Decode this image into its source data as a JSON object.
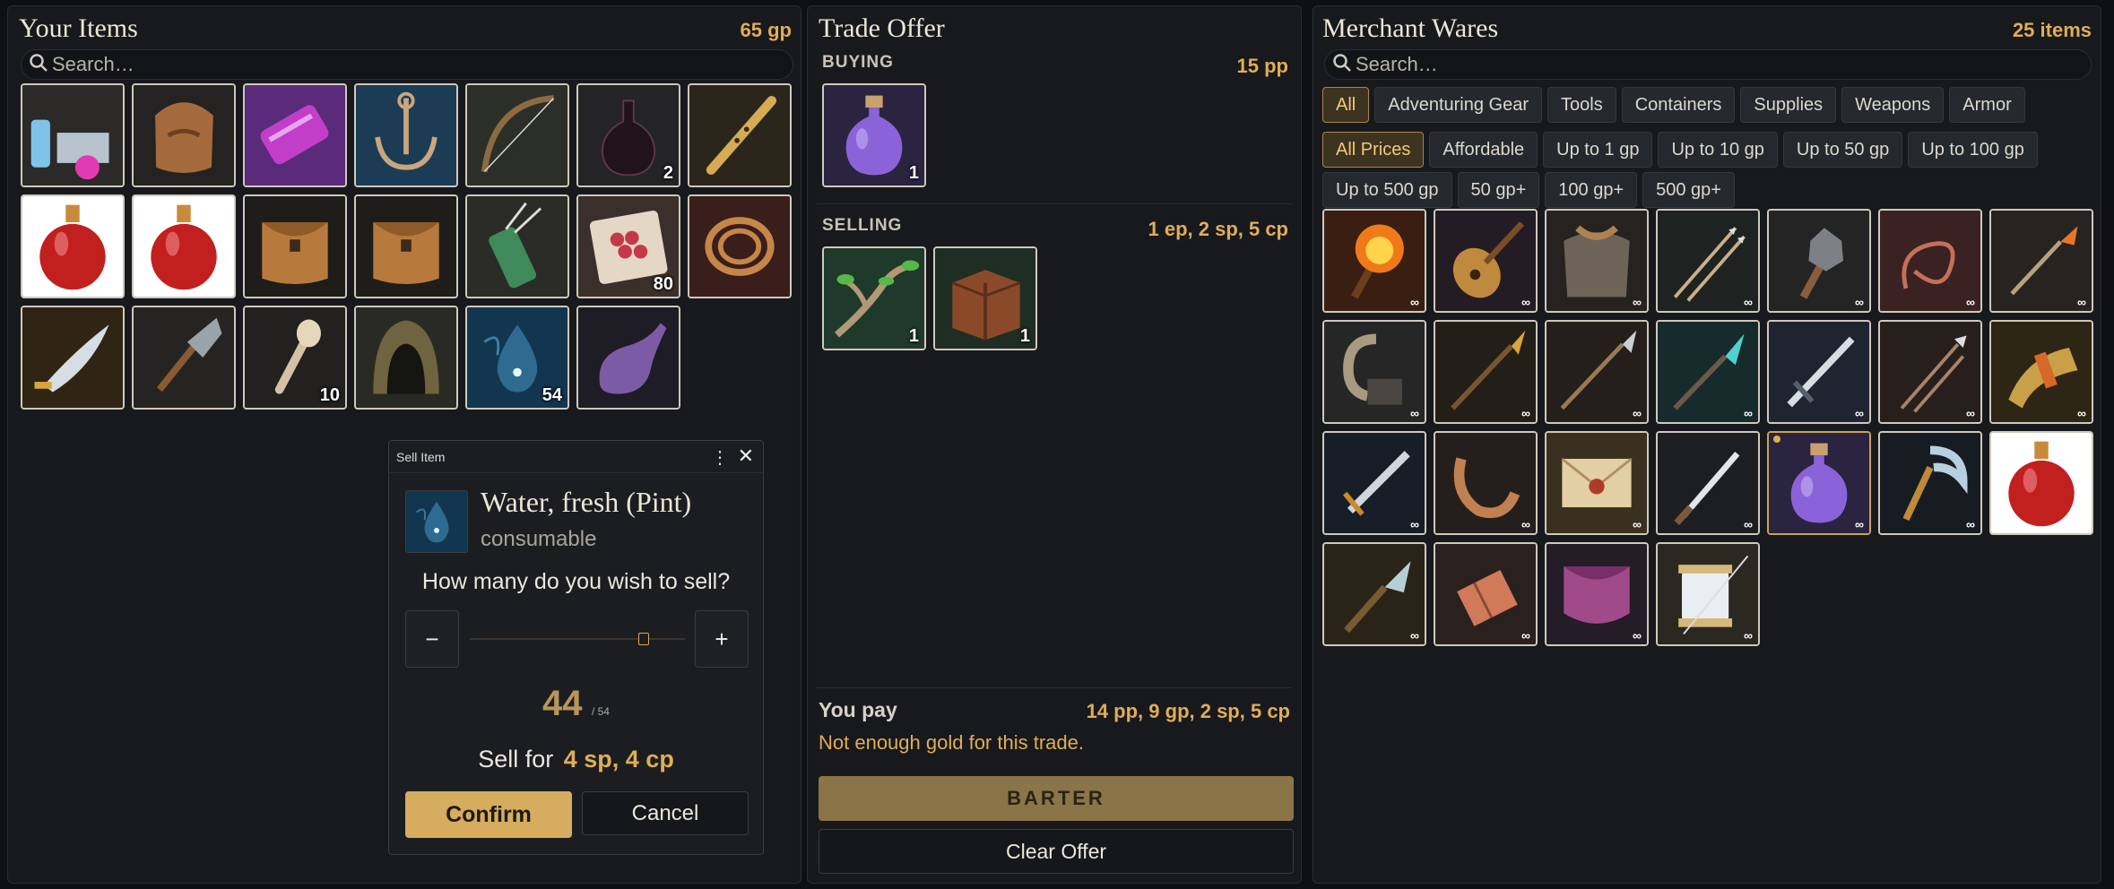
{
  "items_panel": {
    "title": "Your Items",
    "gold": "65 gp",
    "search_placeholder": "Search…",
    "items": [
      {
        "icon": "alchemy-kit-icon",
        "qty": ""
      },
      {
        "icon": "backpack-icon",
        "qty": ""
      },
      {
        "icon": "scroll-icon",
        "qty": ""
      },
      {
        "icon": "grappling-hook-icon",
        "qty": ""
      },
      {
        "icon": "longbow-icon",
        "qty": ""
      },
      {
        "icon": "dark-flask-icon",
        "qty": "2"
      },
      {
        "icon": "flute-icon",
        "qty": ""
      },
      {
        "icon": "red-potion-icon",
        "qty": ""
      },
      {
        "icon": "red-potion-icon",
        "qty": ""
      },
      {
        "icon": "pouch-icon",
        "qty": ""
      },
      {
        "icon": "pouch-icon",
        "qty": ""
      },
      {
        "icon": "quiver-icon",
        "qty": ""
      },
      {
        "icon": "berries-icon",
        "qty": "80"
      },
      {
        "icon": "rope-icon",
        "qty": ""
      },
      {
        "icon": "scimitar-icon",
        "qty": ""
      },
      {
        "icon": "shovel-icon",
        "qty": ""
      },
      {
        "icon": "torch-stick-icon",
        "qty": "10"
      },
      {
        "icon": "hood-icon",
        "qty": ""
      },
      {
        "icon": "water-drop-icon",
        "qty": "54"
      },
      {
        "icon": "purple-flask-icon",
        "qty": ""
      }
    ]
  },
  "trade_panel": {
    "title": "Trade Offer",
    "buying_label": "BUYING",
    "buying_value": "15 pp",
    "buying_items": [
      {
        "icon": "purple-potion-icon",
        "qty": "1"
      }
    ],
    "selling_label": "SELLING",
    "selling_value": "1 ep, 2 sp, 5 cp",
    "selling_items": [
      {
        "icon": "branch-icon",
        "qty": "1"
      },
      {
        "icon": "crate-icon",
        "qty": "1"
      }
    ],
    "you_pay_label": "You pay",
    "you_pay_value": "14 pp, 9 gp, 2 sp, 5 cp",
    "warning": "Not enough gold for this trade.",
    "barter_label": "BARTER",
    "clear_label": "Clear Offer"
  },
  "merchant_panel": {
    "title": "Merchant Wares",
    "count": "25 items",
    "search_placeholder": "Search…",
    "category_filters": [
      "All",
      "Adventuring Gear",
      "Tools",
      "Containers",
      "Supplies",
      "Weapons",
      "Armor"
    ],
    "price_filters_row1": [
      "All Prices",
      "Affordable",
      "Up to 1 gp",
      "Up to 10 gp",
      "Up to 50 gp",
      "Up to 100 gp"
    ],
    "price_filters_row2": [
      "Up to 500 gp",
      "50 gp+",
      "100 gp+",
      "500 gp+"
    ],
    "active_category": "All",
    "active_price": "All Prices",
    "infinite_symbol": "∞",
    "wares": [
      "torch-fire-icon",
      "lute-icon",
      "chain-shirt-icon",
      "arrows-icon",
      "mace-icon",
      "whip-icon",
      "dart-icon",
      "hook-icon",
      "spear-gold-icon",
      "javelin-icon",
      "crystal-spear-icon",
      "longsword-icon",
      "crossbow-bolts-icon",
      "horn-icon",
      "dagger-icon",
      "sling-icon",
      "letter-icon",
      "knife-icon",
      "purple-potion-icon",
      "sickle-icon",
      "red-potion-icon",
      "spearhead-icon",
      "bracer-icon",
      "purple-pouch-icon",
      "sewing-kit-icon"
    ],
    "selected_index": 18
  },
  "sell_dialog": {
    "window_title": "Sell Item",
    "item_name": "Water, fresh (Pint)",
    "item_type": "consumable",
    "question": "How many do you wish to sell?",
    "minus": "−",
    "plus": "+",
    "quantity": "44",
    "max": "/ 54",
    "slider_fraction": 0.81,
    "sell_for_label": "Sell for",
    "sell_for_value": "4 sp, 4 cp",
    "confirm_label": "Confirm",
    "cancel_label": "Cancel"
  },
  "colors": {
    "accent_gold": "#e0ad56",
    "barter_button": "#8a7549",
    "confirm_button": "#d6ac5e"
  }
}
